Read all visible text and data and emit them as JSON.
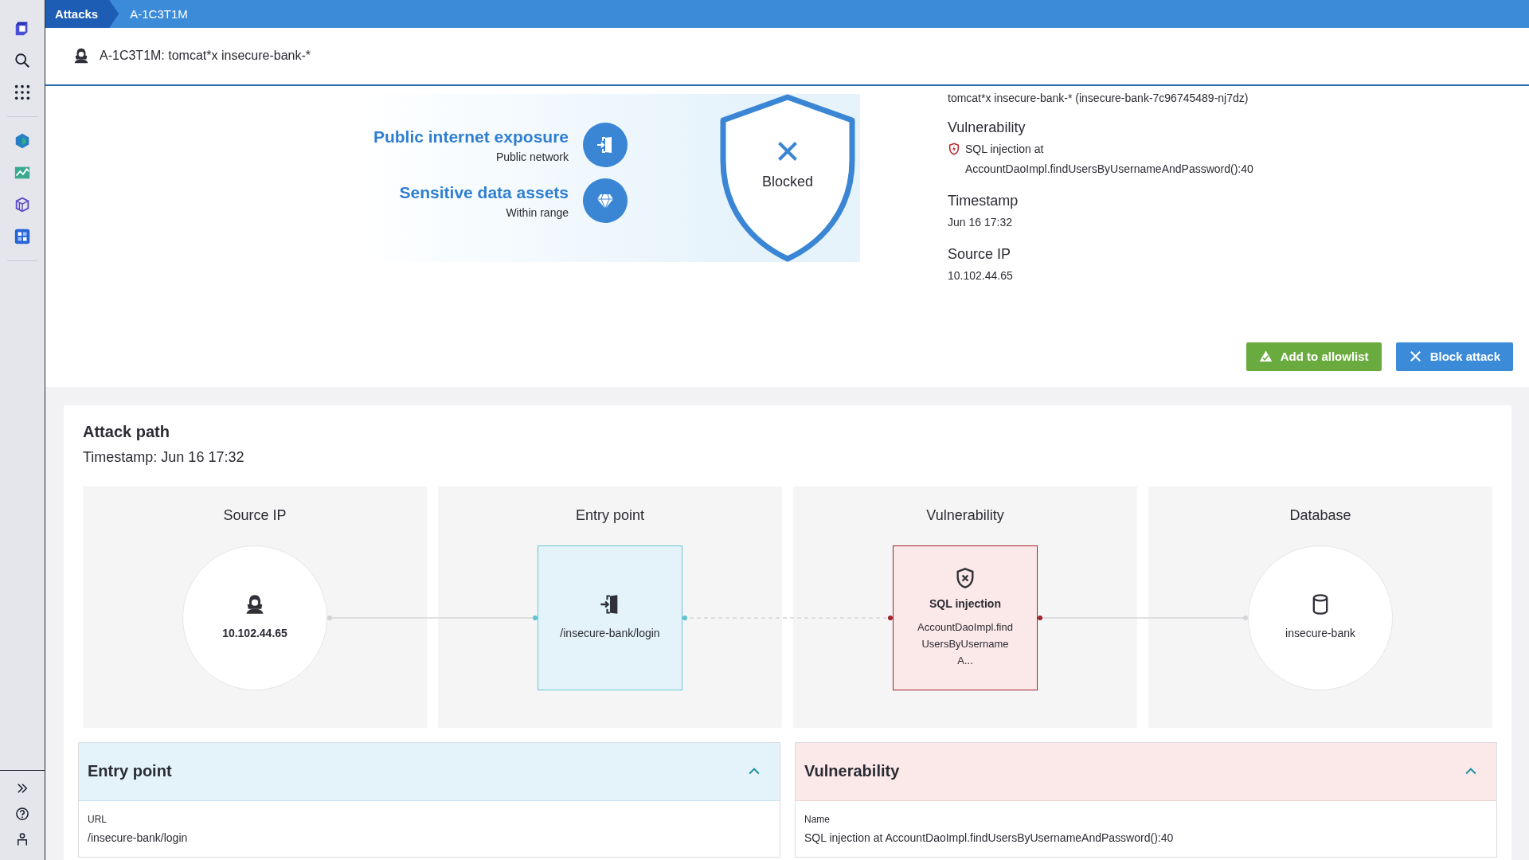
{
  "breadcrumbs": [
    {
      "label": "Attacks",
      "kind": "app"
    },
    {
      "label": "A-1C3T1M",
      "kind": "page"
    }
  ],
  "header": {
    "title": "A-1C3T1M: tomcat*x insecure-bank-*"
  },
  "exposure": {
    "factors": [
      {
        "title": "Public internet exposure",
        "subtitle": "Public network",
        "kind": "network"
      },
      {
        "title": "Sensitive data assets",
        "subtitle": "Within range",
        "kind": "data"
      }
    ],
    "status": "Blocked"
  },
  "details": {
    "process": "tomcat*x insecure-bank-* (insecure-bank-7c96745489-nj7dz)",
    "fields": [
      {
        "label": "Vulnerability",
        "value": "SQL injection at AccountDaoImpl.findUsersByUsernameAndPassword():40",
        "kind": "vulnerability"
      },
      {
        "label": "Timestamp",
        "value": "Jun 16 17:32",
        "kind": "text"
      },
      {
        "label": "Source IP",
        "value": "10.102.44.65",
        "kind": "text"
      }
    ]
  },
  "actions": [
    {
      "label": "Add to allowlist",
      "kind": "allowlist"
    },
    {
      "label": "Block attack",
      "kind": "block"
    }
  ],
  "attack_path": {
    "title": "Attack path",
    "timestamp": "Timestamp: Jun 16 17:32",
    "steps": [
      {
        "heading": "Source IP",
        "kind": "source",
        "label": "10.102.44.65"
      },
      {
        "heading": "Entry point",
        "kind": "entry",
        "label": "/insecure-bank/login"
      },
      {
        "heading": "Vulnerability",
        "kind": "vulnerability",
        "title": "SQL injection",
        "label": "AccountDaoImpl.findUsersByUsernameA..."
      },
      {
        "heading": "Database",
        "kind": "database",
        "label": "insecure-bank"
      }
    ],
    "links": [
      {
        "kind": "solid"
      },
      {
        "kind": "dashed"
      },
      {
        "kind": "solid"
      }
    ]
  },
  "panels": [
    {
      "title": "Entry point",
      "kind": "entry",
      "expanded": true,
      "field_label": "URL",
      "field_value": "/insecure-bank/login"
    },
    {
      "title": "Vulnerability",
      "kind": "vulnerability",
      "expanded": true,
      "field_label": "Name",
      "field_value": "SQL injection at AccountDaoImpl.findUsersByUsernameAndPassword():40"
    }
  ]
}
